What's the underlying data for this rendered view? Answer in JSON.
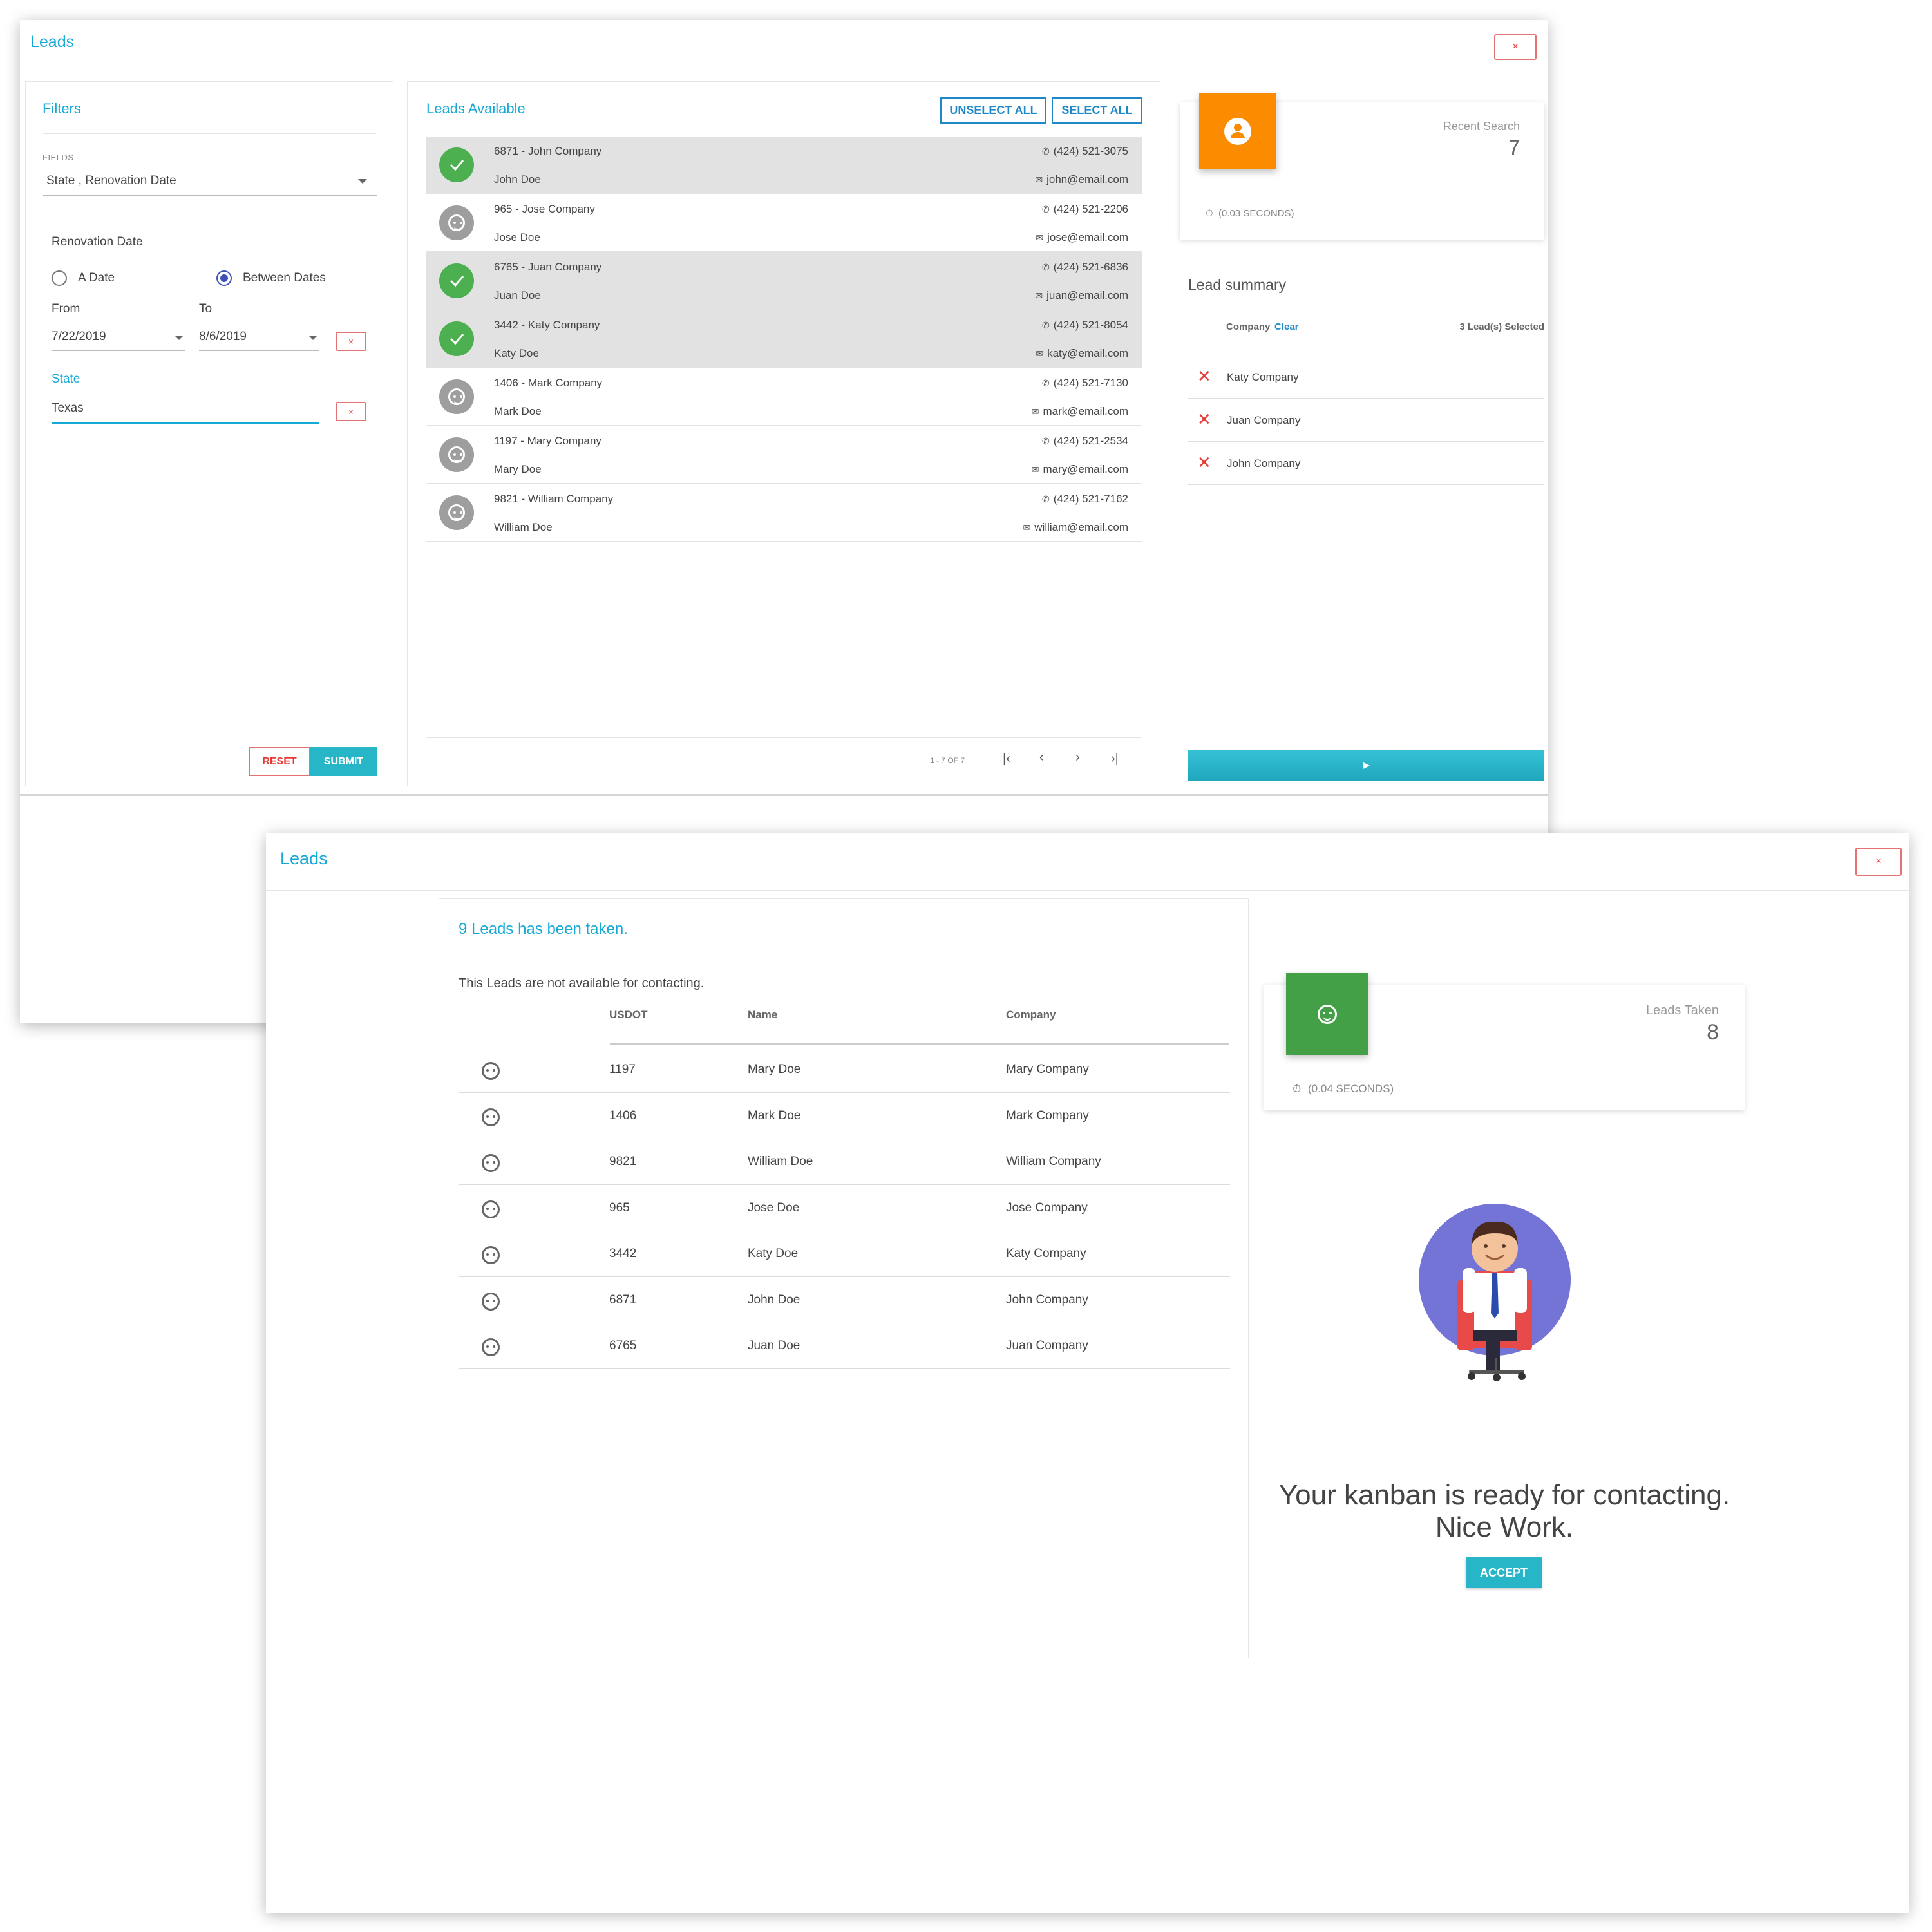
{
  "window1": {
    "title": "Leads",
    "close_label": "×",
    "filters": {
      "title": "Filters",
      "fields_label": "FIELDS",
      "fields_value": "State , Renovation Date",
      "renovation_label": "Renovation Date",
      "radio_a_date": "A Date",
      "radio_between": "Between Dates",
      "from_label": "From",
      "to_label": "To",
      "from_value": "7/22/2019",
      "to_value": "8/6/2019",
      "state_label": "State",
      "state_value": "Texas",
      "clear_label": "×",
      "reset_label": "RESET",
      "submit_label": "SUBMIT"
    },
    "leads": {
      "title": "Leads Available",
      "unselect_all": "UNSELECT ALL",
      "select_all": "SELECT ALL",
      "items": [
        {
          "title": "6871 - John Company",
          "name": "John Doe",
          "phone": "(424) 521-3075",
          "email": "john@email.com",
          "selected": true
        },
        {
          "title": "965 - Jose Company",
          "name": "Jose Doe",
          "phone": "(424) 521-2206",
          "email": "jose@email.com",
          "selected": false
        },
        {
          "title": "6765 - Juan Company",
          "name": "Juan Doe",
          "phone": "(424) 521-6836",
          "email": "juan@email.com",
          "selected": true
        },
        {
          "title": "3442 - Katy Company",
          "name": "Katy Doe",
          "phone": "(424) 521-8054",
          "email": "katy@email.com",
          "selected": true
        },
        {
          "title": "1406 - Mark Company",
          "name": "Mark Doe",
          "phone": "(424) 521-7130",
          "email": "mark@email.com",
          "selected": false
        },
        {
          "title": "1197 - Mary Company",
          "name": "Mary Doe",
          "phone": "(424) 521-2534",
          "email": "mary@email.com",
          "selected": false
        },
        {
          "title": "9821 - William Company",
          "name": "William Doe",
          "phone": "(424) 521-7162",
          "email": "william@email.com",
          "selected": false
        }
      ],
      "page_range": "1 - 7 OF 7"
    },
    "recent": {
      "label": "Recent Search",
      "value": "7",
      "time": "(0.03 SECONDS)"
    },
    "summary": {
      "title": "Lead summary",
      "company_label": "Company",
      "clear_label": "Clear",
      "selected_text": "3 Lead(s) Selected",
      "items": [
        "Katy Company",
        "Juan Company",
        "John Company"
      ]
    },
    "send_icon": "►",
    "colors": {
      "accent": "#17a9d6",
      "orange": "#fb8c00",
      "green": "#4caf50",
      "teal": "#26c6da"
    }
  },
  "window2": {
    "title": "Leads",
    "close_label": "×",
    "taken_title": "9 Leads has been taken.",
    "subtitle": "This Leads are not available for contacting.",
    "headers": {
      "usdot": "USDOT",
      "name": "Name",
      "company": "Company"
    },
    "rows": [
      {
        "usdot": "1197",
        "name": "Mary Doe",
        "company": "Mary Company"
      },
      {
        "usdot": "1406",
        "name": "Mark Doe",
        "company": "Mark Company"
      },
      {
        "usdot": "9821",
        "name": "William Doe",
        "company": "William Company"
      },
      {
        "usdot": "965",
        "name": "Jose Doe",
        "company": "Jose Company"
      },
      {
        "usdot": "3442",
        "name": "Katy Doe",
        "company": "Katy Company"
      },
      {
        "usdot": "6871",
        "name": "John Doe",
        "company": "John Company"
      },
      {
        "usdot": "6765",
        "name": "Juan Doe",
        "company": "Juan Company"
      }
    ],
    "stat": {
      "label": "Leads Taken",
      "value": "8",
      "time": "(0.04 SECONDS)"
    },
    "message_line1": "Your kanban is ready for contacting.",
    "message_line2": "Nice Work.",
    "accept_label": "ACCEPT"
  }
}
